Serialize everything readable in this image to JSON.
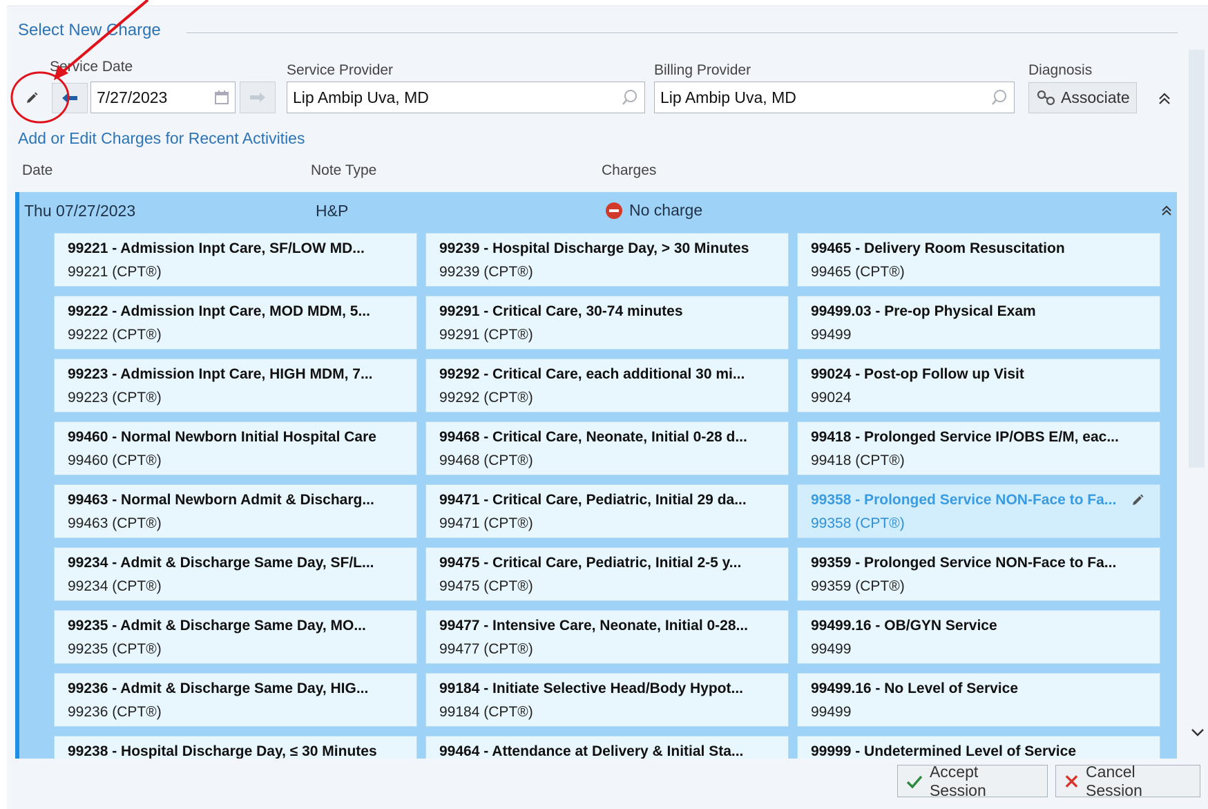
{
  "section_title": "Select New Charge",
  "labels": {
    "service_date": "Service Date",
    "service_provider": "Service Provider",
    "billing_provider": "Billing Provider",
    "diagnosis": "Diagnosis"
  },
  "service_date_value": "7/27/2023",
  "service_provider_value": "Lip Ambip Uva, MD",
  "billing_provider_value": "Lip Ambip Uva, MD",
  "associate_label": "Associate",
  "recent_title": "Add or Edit Charges for Recent Activities",
  "columns": {
    "date": "Date",
    "note_type": "Note Type",
    "charges": "Charges"
  },
  "group": {
    "date": "Thu 07/27/2023",
    "note_type": "H&P",
    "charges": "No charge"
  },
  "charges": [
    [
      {
        "title": "99221 - Admission Inpt Care, SF/LOW MD...",
        "code": "99221 (CPT®)"
      },
      {
        "title": "99239 - Hospital Discharge Day, > 30 Minutes",
        "code": "99239 (CPT®)"
      },
      {
        "title": "99465 - Delivery Room Resuscitation",
        "code": "99465 (CPT®)"
      }
    ],
    [
      {
        "title": "99222 - Admission Inpt Care, MOD MDM, 5...",
        "code": "99222 (CPT®)"
      },
      {
        "title": "99291 - Critical Care, 30-74 minutes",
        "code": "99291 (CPT®)"
      },
      {
        "title": "99499.03 - Pre-op Physical Exam",
        "code": "99499"
      }
    ],
    [
      {
        "title": "99223 - Admission Inpt Care, HIGH MDM, 7...",
        "code": "99223 (CPT®)"
      },
      {
        "title": "99292 - Critical Care, each additional 30 mi...",
        "code": "99292 (CPT®)"
      },
      {
        "title": "99024 - Post-op Follow up Visit",
        "code": "99024"
      }
    ],
    [
      {
        "title": "99460 - Normal Newborn Initial Hospital Care",
        "code": "99460 (CPT®)"
      },
      {
        "title": "99468 - Critical Care, Neonate, Initial 0-28 d...",
        "code": "99468 (CPT®)"
      },
      {
        "title": "99418 - Prolonged Service IP/OBS E/M, eac...",
        "code": "99418 (CPT®)"
      }
    ],
    [
      {
        "title": "99463 - Normal Newborn Admit & Discharg...",
        "code": "99463 (CPT®)"
      },
      {
        "title": "99471 - Critical Care, Pediatric, Initial 29 da...",
        "code": "99471 (CPT®)"
      },
      {
        "title": "99358 - Prolonged Service NON-Face to Fa...",
        "code": "99358 (CPT®)"
      }
    ],
    [
      {
        "title": "99234 - Admit & Discharge Same Day, SF/L...",
        "code": "99234 (CPT®)"
      },
      {
        "title": "99475 - Critical Care, Pediatric, Initial 2-5 y...",
        "code": "99475 (CPT®)"
      },
      {
        "title": "99359 - Prolonged Service NON-Face to Fa...",
        "code": "99359 (CPT®)"
      }
    ],
    [
      {
        "title": "99235 - Admit & Discharge Same Day, MO...",
        "code": "99235 (CPT®)"
      },
      {
        "title": "99477 - Intensive Care, Neonate, Initial 0-28...",
        "code": "99477 (CPT®)"
      },
      {
        "title": "99499.16 - OB/GYN Service",
        "code": "99499"
      }
    ],
    [
      {
        "title": "99236 - Admit & Discharge Same Day, HIG...",
        "code": "99236 (CPT®)"
      },
      {
        "title": "99184 - Initiate Selective Head/Body Hypot...",
        "code": "99184 (CPT®)"
      },
      {
        "title": "99499.16 - No Level of Service",
        "code": "99499"
      }
    ],
    [
      {
        "title": "99238 - Hospital Discharge Day, ≤ 30 Minutes",
        "code": ""
      },
      {
        "title": "99464 - Attendance at Delivery & Initial Sta...",
        "code": ""
      },
      {
        "title": "99999 - Undetermined Level of Service",
        "code": ""
      }
    ]
  ],
  "highlighted_card": "99358",
  "footer": {
    "accept": "Accept Session",
    "cancel": "Cancel Session"
  },
  "colors": {
    "accent": "#2c74b5",
    "group_bg": "#9ed3f7",
    "card_bg": "#e8f6fd",
    "annotation": "#e0121b"
  },
  "icons": [
    "pencil-icon",
    "arrow-left-icon",
    "calendar-icon",
    "arrow-right-icon",
    "search-icon",
    "associate-icon",
    "collapse-icon",
    "no-charge-icon",
    "checkmark-icon",
    "close-x-icon",
    "scroll-up-icon",
    "scroll-down-icon"
  ]
}
